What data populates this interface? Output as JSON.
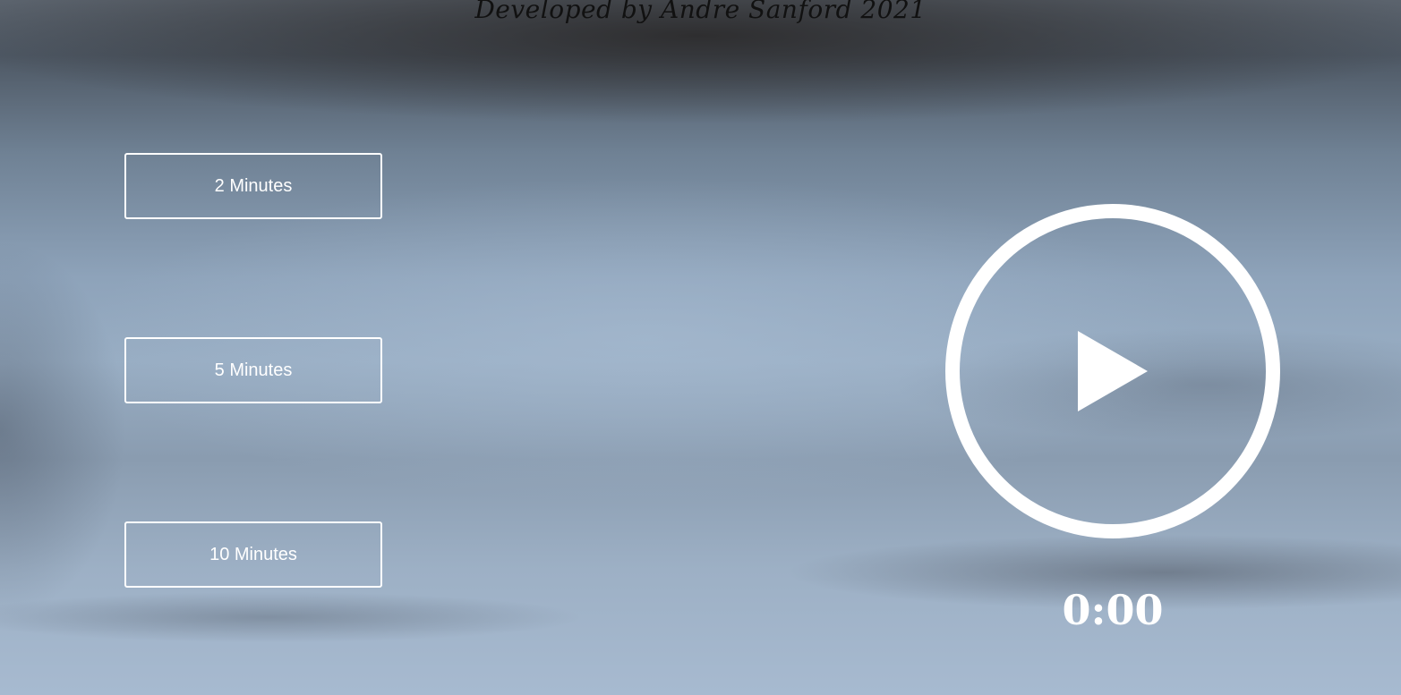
{
  "footer": {
    "credit": "Developed by Andre Sanford 2021"
  },
  "durations": {
    "two": "2 Minutes",
    "five": "5 Minutes",
    "ten": "10 Minutes"
  },
  "player": {
    "icon": "play-icon",
    "timer": "0:00"
  },
  "colors": {
    "foreground": "#ffffff",
    "credit_text": "#111111"
  }
}
